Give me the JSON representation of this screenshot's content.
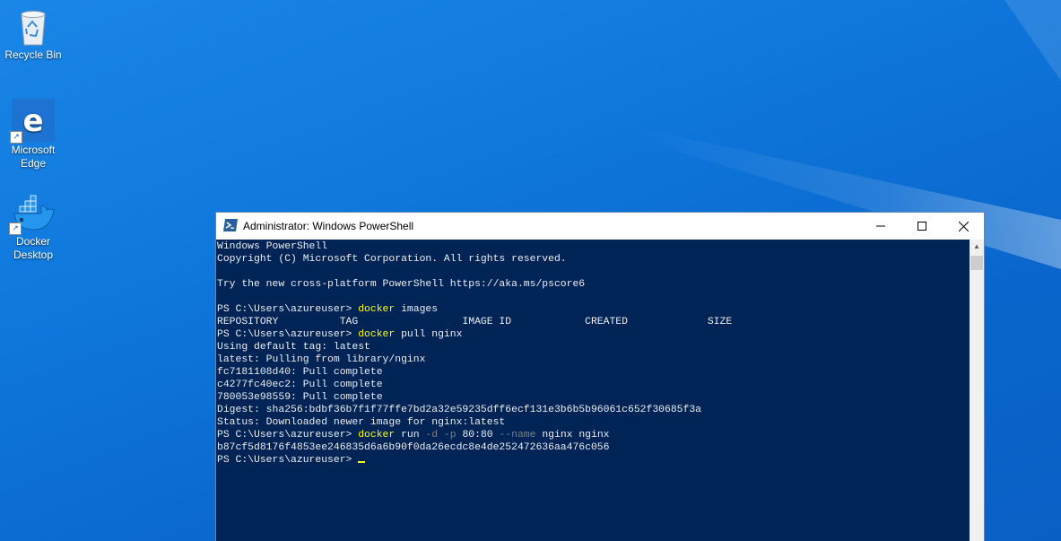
{
  "desktop": {
    "icons": [
      {
        "label": "Recycle Bin",
        "icon": "recycle-bin-icon"
      },
      {
        "label": "Microsoft Edge",
        "icon": "edge-icon"
      },
      {
        "label": "Docker Desktop",
        "icon": "docker-icon"
      }
    ]
  },
  "window": {
    "title": "Administrator: Windows PowerShell",
    "controls": {
      "minimize": "minimize-icon",
      "maximize": "maximize-icon",
      "close": "close-icon"
    }
  },
  "console": {
    "lines": [
      {
        "text": "Windows PowerShell"
      },
      {
        "text": "Copyright (C) Microsoft Corporation. All rights reserved."
      },
      {
        "text": ""
      },
      {
        "text": "Try the new cross-platform PowerShell https://aka.ms/pscore6"
      },
      {
        "text": ""
      },
      {
        "prompt": "PS C:\\Users\\azureuser> ",
        "cmd": "docker",
        "args": " images"
      },
      {
        "text": "REPOSITORY          TAG                 IMAGE ID            CREATED             SIZE"
      },
      {
        "prompt": "PS C:\\Users\\azureuser> ",
        "cmd": "docker",
        "args": " pull nginx"
      },
      {
        "text": "Using default tag: latest"
      },
      {
        "text": "latest: Pulling from library/nginx"
      },
      {
        "text": "fc7181108d40: Pull complete"
      },
      {
        "text": "c4277fc40ec2: Pull complete"
      },
      {
        "text": "780053e98559: Pull complete"
      },
      {
        "text": "Digest: sha256:bdbf36b7f1f77ffe7bd2a32e59235dff6ecf131e3b6b5b96061c652f30685f3a"
      },
      {
        "text": "Status: Downloaded newer image for nginx:latest"
      },
      {
        "prompt": "PS C:\\Users\\azureuser> ",
        "cmd": "docker",
        "args": " run ",
        "flag1": "-d -p",
        "mid": " 80:80 ",
        "flag2": "--name",
        "tail": " nginx nginx"
      },
      {
        "text": "b87cf5d8176f4853ee246835d6a6b90f0da26ecdc8e4de252472636aa476c056"
      },
      {
        "prompt": "PS C:\\Users\\azureuser> ",
        "cursor": true
      }
    ]
  },
  "colors": {
    "console_bg": "#012456",
    "console_fg": "#eeedf0",
    "command": "#ffff00",
    "parameter": "#808080"
  }
}
